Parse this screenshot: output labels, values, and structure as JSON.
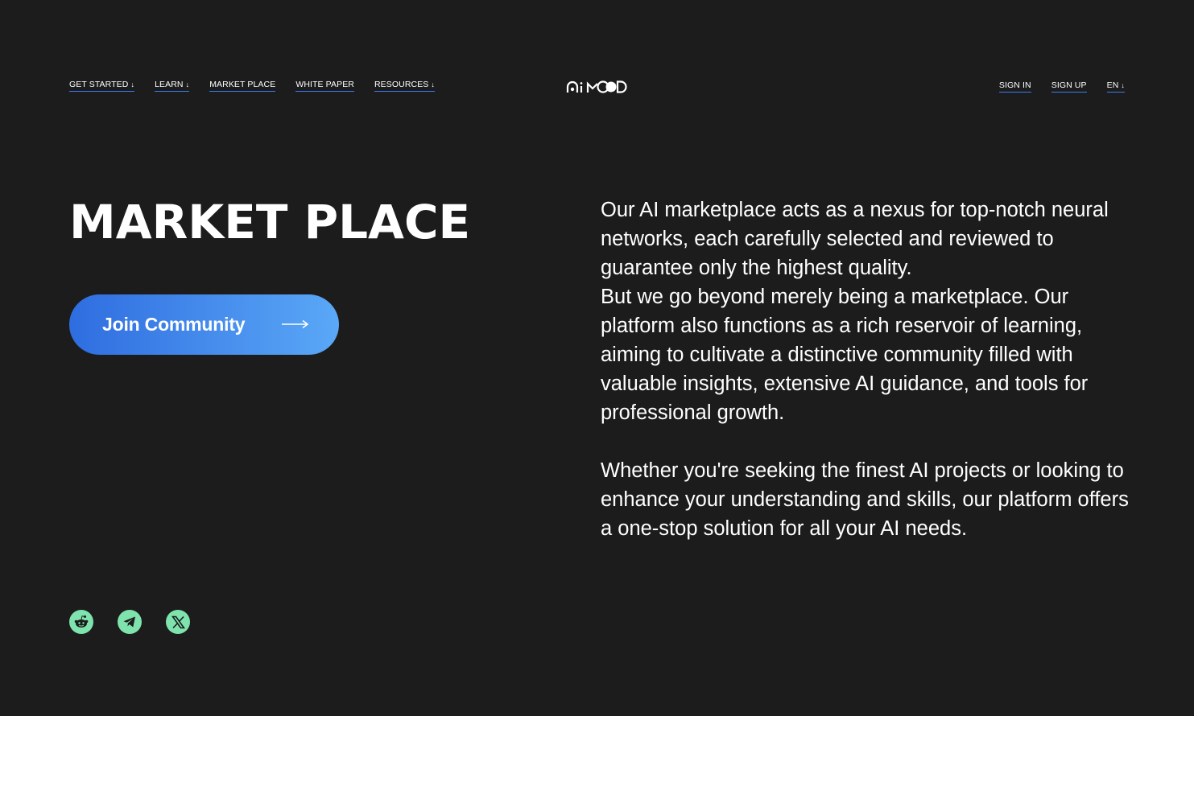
{
  "nav": {
    "left": [
      {
        "label": "GET STARTED",
        "arrow": "↓"
      },
      {
        "label": "LEARN",
        "arrow": "↓"
      },
      {
        "label": "MARKET PLACE",
        "arrow": ""
      },
      {
        "label": "WHITE PAPER",
        "arrow": ""
      },
      {
        "label": "RESOURCES",
        "arrow": "↓"
      }
    ],
    "right": [
      {
        "label": "SIGN IN",
        "arrow": ""
      },
      {
        "label": "SIGN UP",
        "arrow": ""
      },
      {
        "label": "EN",
        "arrow": "↓"
      }
    ],
    "logo_text": "AiMOOD"
  },
  "hero": {
    "title": "MARKET PLACE",
    "cta_label": "Join Community",
    "description": [
      "Our AI marketplace acts as a nexus for top-notch neural networks, each carefully selected and reviewed to guarantee only the highest quality.",
      "But we go beyond merely being a marketplace. Our platform also functions as a rich reservoir of learning, aiming to cultivate a distinctive community filled with valuable insights, extensive AI guidance, and tools for professional growth.",
      "Whether you're seeking the finest AI projects or looking to enhance your understanding and skills, our platform offers a one-stop solution for all your AI needs."
    ]
  },
  "socials": [
    {
      "icon": "reddit-icon"
    },
    {
      "icon": "telegram-icon"
    },
    {
      "icon": "x-icon"
    }
  ],
  "colors": {
    "background": "#1c1c1c",
    "accent_start": "#2f6de0",
    "accent_end": "#5aa8f7",
    "social_bg": "#7ee3ad",
    "underline": "#3d7bf0"
  }
}
